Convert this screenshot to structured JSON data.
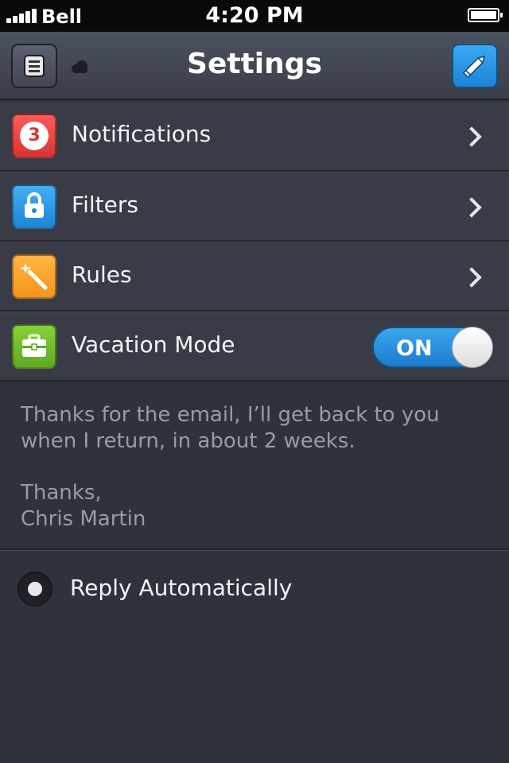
{
  "status_bar": {
    "carrier": "Bell",
    "time": "4:20 PM"
  },
  "nav": {
    "title": "Settings",
    "left_icon": "menu-list-icon",
    "right_icon": "pencil-icon"
  },
  "rows": [
    {
      "label": "Notifications",
      "icon": "notification-badge-icon",
      "badge": "3",
      "color": "#e93d3d"
    },
    {
      "label": "Filters",
      "icon": "lock-icon",
      "color": "#2a94e2"
    },
    {
      "label": "Rules",
      "icon": "magic-wand-icon",
      "color": "#f7a22c"
    },
    {
      "label": "Vacation Mode",
      "icon": "briefcase-icon",
      "color": "#6dbb27",
      "toggle": "ON"
    }
  ],
  "message": {
    "body": "Thanks for the email, I’ll get back to you when I return, in about 2 weeks.",
    "signoff": "Thanks,",
    "name": "Chris Martin"
  },
  "reply": {
    "label": "Reply Automatically"
  }
}
